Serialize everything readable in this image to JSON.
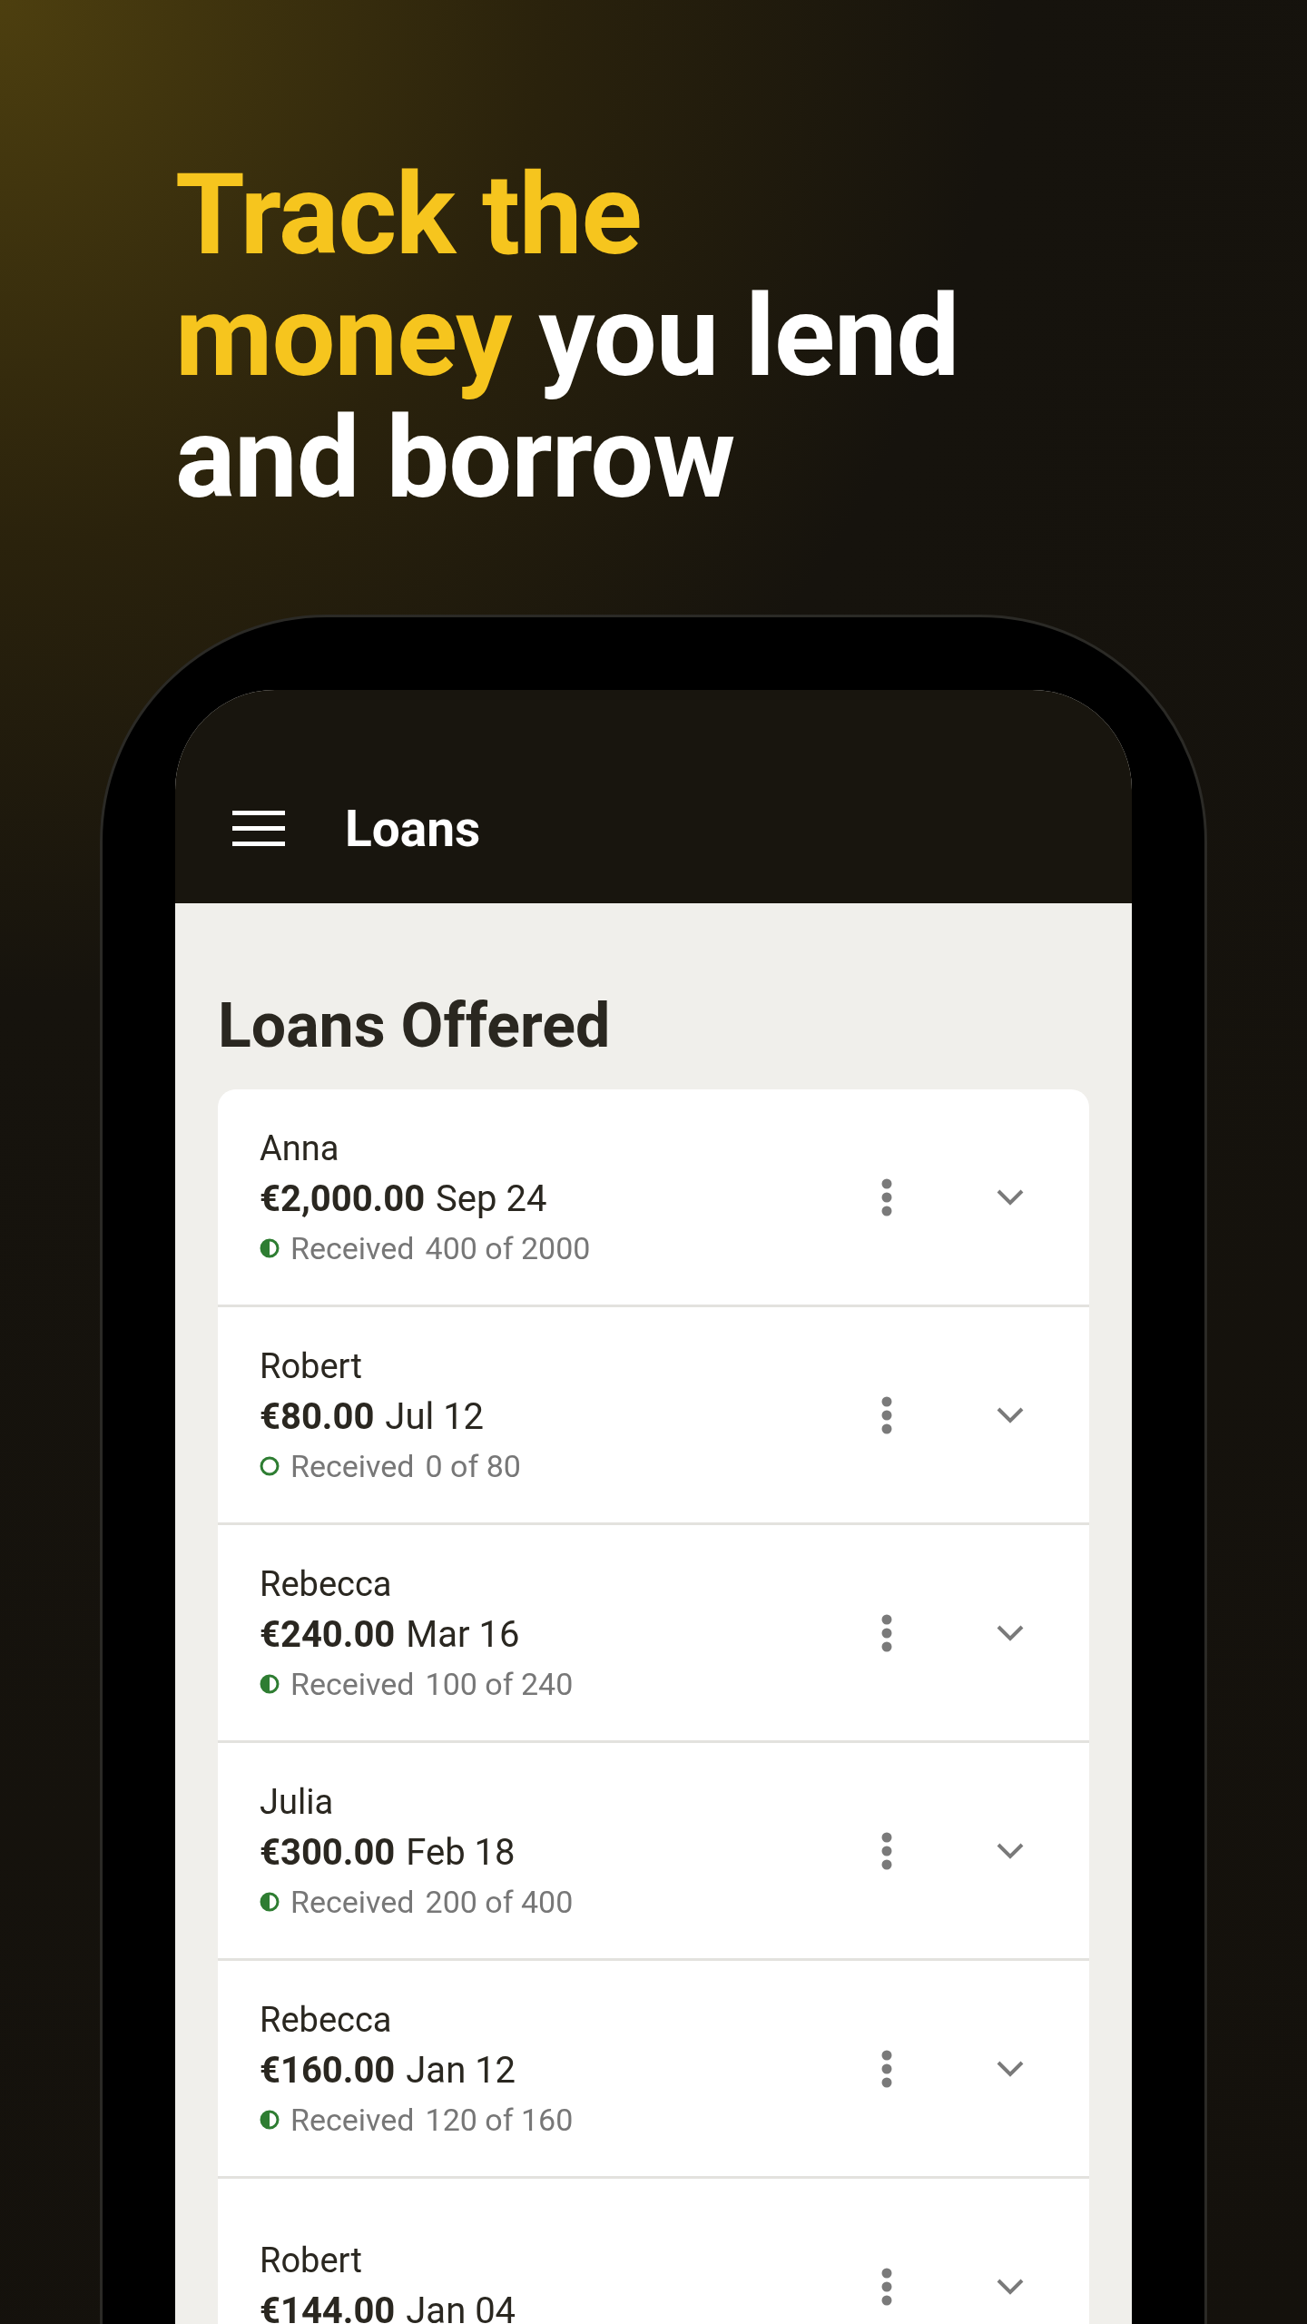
{
  "headline": [
    [
      {
        "text": "Track the",
        "highlight": true
      }
    ],
    [
      {
        "text": "money",
        "highlight": true
      },
      {
        "text": "you lend",
        "highlight": false
      }
    ],
    [
      {
        "text": "and borrow",
        "highlight": false
      }
    ]
  ],
  "app_bar": {
    "title": "Loans"
  },
  "section_title": "Loans Offered",
  "loans": [
    {
      "name": "Anna",
      "amount": "€2,000.00",
      "date": "Sep 24",
      "partial": true,
      "status_label": "Received",
      "progress": "400 of 2000"
    },
    {
      "name": "Robert",
      "amount": "€80.00",
      "date": "Jul 12",
      "partial": false,
      "status_label": "Received",
      "progress": "0 of 80"
    },
    {
      "name": "Rebecca",
      "amount": "€240.00",
      "date": "Mar 16",
      "partial": true,
      "status_label": "Received",
      "progress": "100 of 240"
    },
    {
      "name": "Julia",
      "amount": "€300.00",
      "date": "Feb 18",
      "partial": true,
      "status_label": "Received",
      "progress": "200 of 400"
    },
    {
      "name": "Rebecca",
      "amount": "€160.00",
      "date": "Jan 12",
      "partial": true,
      "status_label": "Received",
      "progress": "120 of 160"
    },
    {
      "name": "Robert",
      "amount": "€144.00",
      "date": "Jan 04"
    }
  ]
}
